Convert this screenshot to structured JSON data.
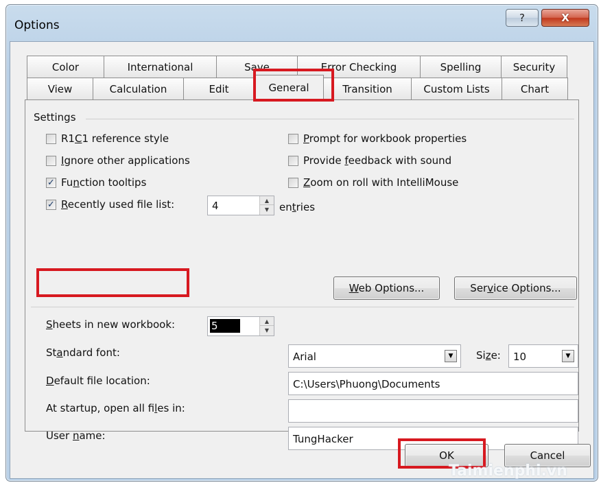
{
  "window": {
    "title": "Options",
    "help_glyph": "?",
    "close_glyph": "X"
  },
  "tabs": {
    "row1": [
      "Color",
      "International",
      "Save",
      "Error Checking",
      "Spelling",
      "Security"
    ],
    "row2": [
      "View",
      "Calculation",
      "Edit",
      "General",
      "Transition",
      "Custom Lists",
      "Chart"
    ],
    "active": "General"
  },
  "settings": {
    "group_label": "Settings",
    "r1c1_pre": "R1",
    "r1c1_u": "C",
    "r1c1_post": "1 reference style",
    "ignore_u": "I",
    "ignore_post": "gnore other applications",
    "func_pre": "Fu",
    "func_u": "n",
    "func_post": "ction tooltips",
    "recent_u": "R",
    "recent_post": "ecently used file list:",
    "recent_value": "4",
    "entries_pre": "en",
    "entries_u": "t",
    "entries_post": "ries",
    "prompt_u": "P",
    "prompt_post": "rompt for workbook properties",
    "feedback_pre": "Provide ",
    "feedback_u": "f",
    "feedback_post": "eedback with sound",
    "zoom_u": "Z",
    "zoom_post": "oom on roll with IntelliMouse",
    "checked": {
      "r1c1": false,
      "ignore": false,
      "func": true,
      "recent": true,
      "prompt": false,
      "feedback": false,
      "zoom": false
    },
    "check_glyph": "✓"
  },
  "buttons": {
    "web_u": "W",
    "web_post": "eb Options...",
    "service_pre": "Ser",
    "service_u": "v",
    "service_post": "ice Options...",
    "ok": "OK",
    "cancel": "Cancel"
  },
  "general": {
    "sheets_u": "S",
    "sheets_post": "heets in new workbook:",
    "sheets_value": "5",
    "font_pre": "St",
    "font_u": "a",
    "font_post": "ndard font:",
    "font_value": "Arial",
    "size_pre": "Si",
    "size_u": "z",
    "size_post": "e:",
    "size_value": "10",
    "location_u": "D",
    "location_post": "efault file location:",
    "location_value": "C:\\Users\\Phuong\\Documents",
    "startup_pre": "At startup, open all fi",
    "startup_u": "l",
    "startup_post": "es in:",
    "startup_value": "",
    "username_pre": "User ",
    "username_u": "n",
    "username_post": "ame:",
    "username_value": "TungHacker"
  },
  "icons": {
    "spin_up": "▲",
    "spin_down": "▼",
    "dropdown": "▼"
  },
  "watermark": "Taimienphi.vn",
  "colors": {
    "highlight": "#d71920",
    "close_button": "#c1381d",
    "frame": "#b9d0e7"
  }
}
